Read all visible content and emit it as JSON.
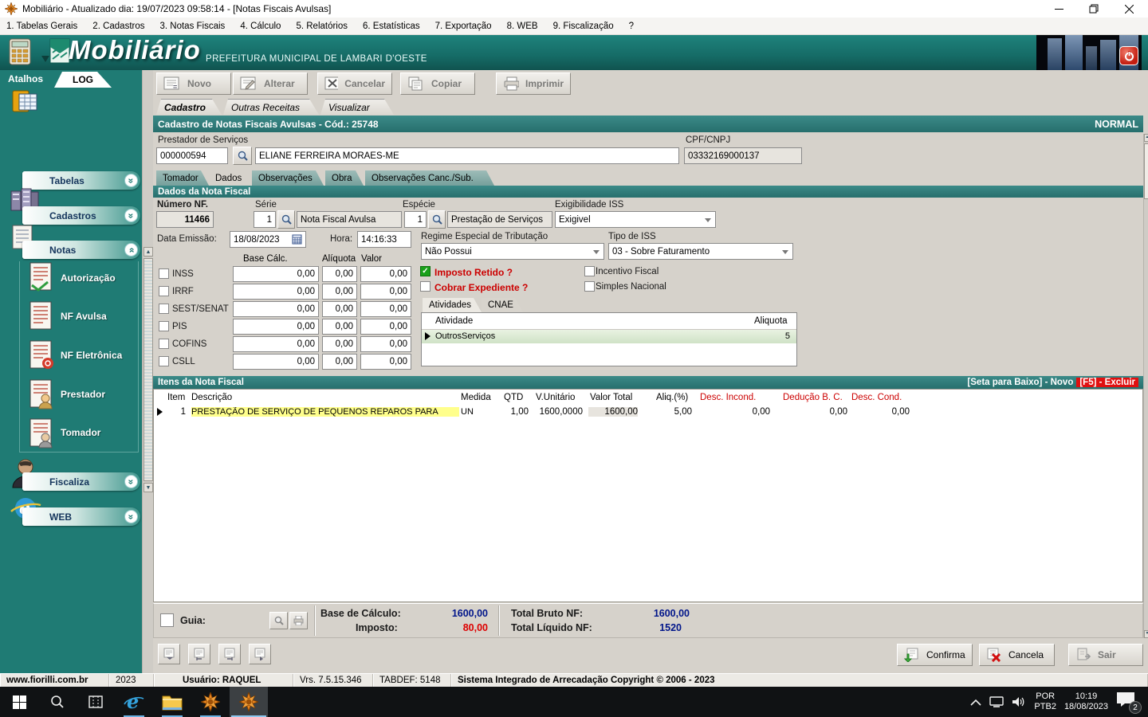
{
  "window": {
    "title": "Mobiliário - Atualizado dia: 19/07/2023 09:58:14 - [Notas Fiscais Avulsas]"
  },
  "menu": {
    "items": [
      "1. Tabelas Gerais",
      "2. Cadastros",
      "3. Notas Fiscais",
      "4. Cálculo",
      "5. Relatórios",
      "6. Estatísticas",
      "7. Exportação",
      "8. WEB",
      "9. Fiscalização",
      "?"
    ]
  },
  "brand": {
    "logo": "Mobiliário",
    "subtitle": "PREFEITURA MUNICIPAL DE LAMBARI D'OESTE"
  },
  "sidebar": {
    "atalhos": "Atalhos",
    "log": "LOG",
    "groups": {
      "tabelas": "Tabelas",
      "cadastros": "Cadastros",
      "notas": "Notas",
      "fiscaliza": "Fiscaliza",
      "web": "WEB"
    },
    "notas_items": [
      "Autorização",
      "NF Avulsa",
      "NF Eletrônica",
      "Prestador",
      "Tomador"
    ]
  },
  "toolbar": {
    "novo": "Novo",
    "alterar": "Alterar",
    "cancelar": "Cancelar",
    "copiar": "Copiar",
    "imprimir": "Imprimir"
  },
  "main_tabs": [
    "Cadastro",
    "Outras Receitas",
    "Visualizar"
  ],
  "header": {
    "title": "Cadastro de Notas Fiscais Avulsas - Cód.: 25748",
    "status": "NORMAL"
  },
  "prestador": {
    "label": "Prestador de Serviços",
    "code": "000000594",
    "name": "ELIANE FERREIRA MORAES-ME",
    "cpf_label": "CPF/CNPJ",
    "cpf": "03332169000137"
  },
  "sub_tabs": [
    "Tomador",
    "Dados",
    "Observações",
    "Obra",
    "Observações Canc./Sub."
  ],
  "dados": {
    "section_title": "Dados da Nota Fiscal",
    "numero_label": "Número NF.",
    "numero": "11466",
    "serie_label": "Série",
    "serie": "1",
    "serie_desc": "Nota Fiscal Avulsa",
    "especie_label": "Espécie",
    "especie": "1",
    "especie_desc": "Prestação de Serviços",
    "exig_label": "Exigibilidade ISS",
    "exig": "Exigivel",
    "data_label": "Data Emissão:",
    "data": "18/08/2023",
    "hora_label": "Hora:",
    "hora": "14:16:33",
    "regime_label": "Regime Especial de Tributação",
    "regime": "Não Possui",
    "tipo_iss_label": "Tipo de ISS",
    "tipo_iss": "03 - Sobre Faturamento"
  },
  "impostos": {
    "col_base": "Base Cálc.",
    "col_aliquota": "Alíquota",
    "col_valor": "Valor",
    "rows": [
      {
        "label": "INSS",
        "base": "0,00",
        "aliquota": "0,00",
        "valor": "0,00"
      },
      {
        "label": "IRRF",
        "base": "0,00",
        "aliquota": "0,00",
        "valor": "0,00"
      },
      {
        "label": "SEST/SENAT",
        "base": "0,00",
        "aliquota": "0,00",
        "valor": "0,00"
      },
      {
        "label": "PIS",
        "base": "0,00",
        "aliquota": "0,00",
        "valor": "0,00"
      },
      {
        "label": "COFINS",
        "base": "0,00",
        "aliquota": "0,00",
        "valor": "0,00"
      },
      {
        "label": "CSLL",
        "base": "0,00",
        "aliquota": "0,00",
        "valor": "0,00"
      }
    ]
  },
  "flags": {
    "imposto_retido": "Imposto Retido ?",
    "cobrar_expediente": "Cobrar Expediente ?",
    "incentivo_fiscal": "Incentivo Fiscal",
    "simples_nacional": "Simples Nacional"
  },
  "atividades": {
    "tab_atividades": "Atividades",
    "tab_cnae": "CNAE",
    "col_atividade": "Atividade",
    "col_aliquota": "Aliquota",
    "row": {
      "atividade": "OutrosServiços",
      "aliquota": "5"
    }
  },
  "itens": {
    "section_title": "Itens da Nota Fiscal",
    "hint_novo": "[Seta para Baixo] - Novo",
    "hint_excluir": "[F5] - Excluir",
    "columns": [
      "Item",
      "Descrição",
      "Medida",
      "QTD",
      "V.Unitário",
      "Valor Total",
      "Aliq.(%)",
      "Desc. Incond.",
      "Dedução B. C.",
      "Desc. Cond."
    ],
    "row": {
      "item": "1",
      "descricao": "PRESTAÇÃO DE SERVIÇO DE PEQUENOS REPAROS PARA",
      "medida": "UN",
      "qtd": "1,00",
      "v_unitario": "1600,0000",
      "valor_total": "1600,00",
      "aliq": "5,00",
      "desc_incond": "0,00",
      "deducao": "0,00",
      "desc_cond": "0,00"
    }
  },
  "totais": {
    "guia_label": "Guia:",
    "base_label": "Base de Cálculo:",
    "base": "1600,00",
    "imposto_label": "Imposto:",
    "imposto": "80,00",
    "bruto_label": "Total Bruto NF:",
    "bruto": "1600,00",
    "liquido_label": "Total Líquido NF:",
    "liquido": "1520"
  },
  "actions": {
    "confirma": "Confirma",
    "cancela": "Cancela",
    "sair": "Sair"
  },
  "statusbar": {
    "site": "www.fiorilli.com.br",
    "year": "2023",
    "user": "Usuário: RAQUEL",
    "version": "Vrs. 7.5.15.346",
    "tabdef": "TABDEF: 5148",
    "copyright": "Sistema Integrado de Arrecadação Copyright © 2006 - 2023"
  },
  "taskbar": {
    "lang1": "POR",
    "lang2": "PTB2",
    "time": "10:19",
    "date": "18/08/2023",
    "badge": "2"
  },
  "icons": {
    "app_flower": "orange 8-point starburst",
    "lookup": "magnifier",
    "calendar": "calendar grid",
    "power": "power symbol",
    "confirm": "green arrow + check",
    "cancel": "red x",
    "chevron_double": "»"
  },
  "colors": {
    "teal_banner": "#17736d",
    "section_teal": "#2e7c7a",
    "accent_red": "#cc0000",
    "value_blue": "#00158a",
    "highlight_yellow": "#ffff8c",
    "row_green": "#d9e8d2",
    "excluir_red": "#e01010"
  }
}
